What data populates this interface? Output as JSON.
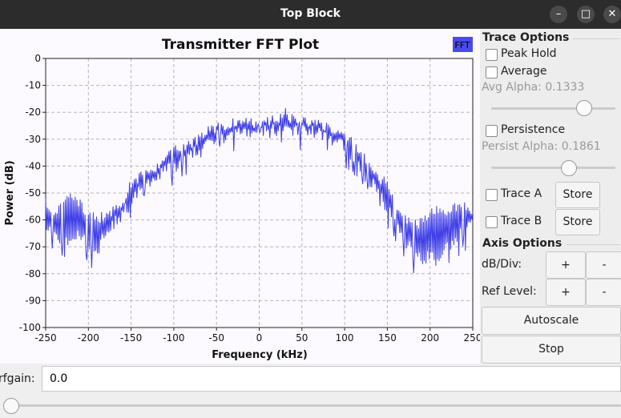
{
  "window": {
    "title": "Top Block",
    "minimize_symbol": "–",
    "maximize_symbol": "□",
    "close_symbol": "✕"
  },
  "plot": {
    "title": "Transmitter FFT Plot",
    "legend_label": "FFT",
    "series_color": "#3c3ce6"
  },
  "chart_data": {
    "type": "line",
    "title": "Transmitter FFT Plot",
    "xlabel": "Frequency (kHz)",
    "ylabel": "Power (dB)",
    "xlim": [
      -250,
      250
    ],
    "ylim": [
      -100,
      0
    ],
    "xticks": [
      -250,
      -200,
      -150,
      -100,
      -50,
      0,
      50,
      100,
      150,
      200,
      250
    ],
    "yticks": [
      0,
      -10,
      -20,
      -30,
      -40,
      -50,
      -60,
      -70,
      -80,
      -90,
      -100
    ],
    "grid": true,
    "legend_position": "top-right",
    "series": [
      {
        "name": "FFT",
        "x": [
          -250,
          -240,
          -230,
          -220,
          -210,
          -200,
          -190,
          -180,
          -170,
          -160,
          -150,
          -140,
          -130,
          -120,
          -110,
          -100,
          -90,
          -80,
          -70,
          -60,
          -50,
          -40,
          -30,
          -20,
          -10,
          0,
          10,
          20,
          30,
          40,
          50,
          60,
          70,
          80,
          90,
          100,
          110,
          120,
          130,
          140,
          150,
          160,
          170,
          180,
          190,
          200,
          210,
          220,
          230,
          240,
          250
        ],
        "upper": [
          -52,
          -55,
          -52,
          -49,
          -52,
          -56,
          -58,
          -56,
          -54,
          -53,
          -44,
          -42,
          -40,
          -38,
          -34,
          -32,
          -31,
          -30,
          -28,
          -25,
          -24,
          -23,
          -22,
          -21,
          -22,
          -23,
          -21,
          -21,
          -18,
          -21,
          -22,
          -21,
          -23,
          -24,
          -26,
          -25,
          -30,
          -34,
          -38,
          -42,
          -45,
          -52,
          -58,
          -60,
          -59,
          -56,
          -54,
          -57,
          -53,
          -52,
          -55
        ],
        "lower": [
          -65,
          -67,
          -72,
          -70,
          -68,
          -72,
          -73,
          -68,
          -64,
          -60,
          -55,
          -52,
          -50,
          -47,
          -44,
          -43,
          -40,
          -38,
          -37,
          -34,
          -31,
          -33,
          -31,
          -29,
          -30,
          -28,
          -30,
          -29,
          -27,
          -29,
          -28,
          -30,
          -30,
          -31,
          -35,
          -34,
          -40,
          -45,
          -48,
          -52,
          -58,
          -64,
          -70,
          -74,
          -78,
          -75,
          -80,
          -72,
          -70,
          -66,
          -64
        ]
      }
    ]
  },
  "trace_options": {
    "title": "Trace Options",
    "peak_hold": "Peak Hold",
    "average": "Average",
    "avg_alpha_label": "Avg Alpha:",
    "avg_alpha_value": "0.1333",
    "avg_alpha_fraction": 0.74,
    "persistence": "Persistence",
    "persist_alpha_label": "Persist Alpha:",
    "persist_alpha_value": "0.1861",
    "persist_alpha_fraction": 0.62,
    "trace_a": "Trace A",
    "trace_b": "Trace B",
    "store": "Store"
  },
  "axis_options": {
    "title": "Axis Options",
    "db_div": "dB/Div:",
    "ref_level": "Ref Level:",
    "plus": "+",
    "minus": "-",
    "autoscale": "Autoscale",
    "stop": "Stop"
  },
  "rfgain": {
    "label": "rfgain:",
    "value": "0.0",
    "slider_fraction": 0.0
  }
}
